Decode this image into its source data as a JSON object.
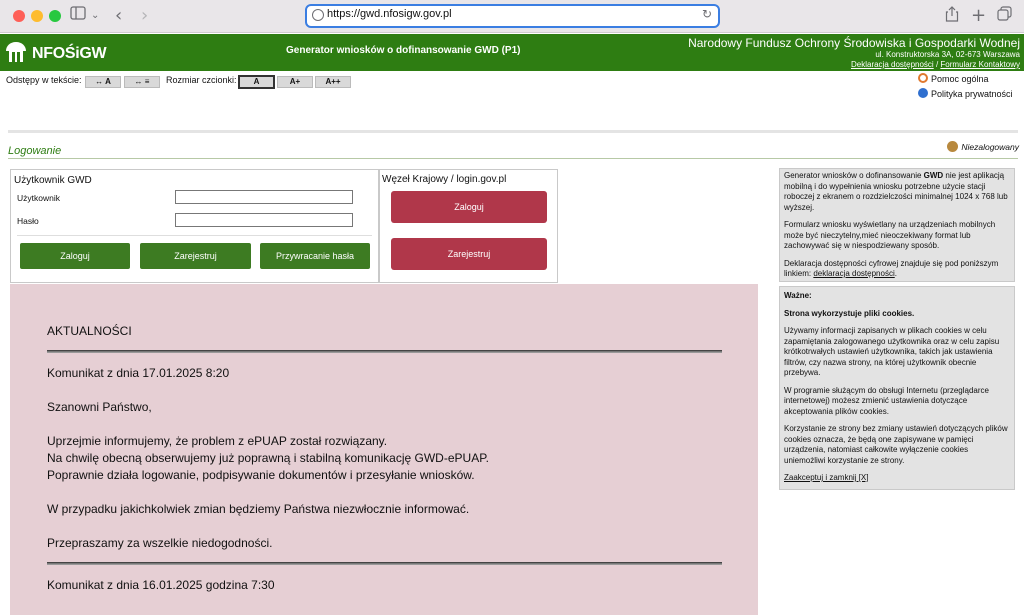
{
  "browser": {
    "url": "https://gwd.nfosigw.gov.pl"
  },
  "header": {
    "logo_text": "NFOŚiGW",
    "app_title": "Generator wniosków o dofinansowanie GWD (P1)",
    "org_name": "Narodowy Fundusz Ochrony Środowiska i Gospodarki Wodnej",
    "org_address": "ul. Konstruktorska 3A, 02-673 Warszawa",
    "link_accessibility": "Deklaracja dostępności",
    "link_separator": "/",
    "link_contact": "Formularz Kontaktowy"
  },
  "toolbar": {
    "spacing_label": "Odstępy w tekście:",
    "spacing_btn1": "↔ A",
    "spacing_btn2": "↔ ≡",
    "font_label": "Rozmiar czcionki:",
    "font_a": "A",
    "font_a_plus": "A+",
    "font_a_plus_plus": "A++"
  },
  "right_links": {
    "help": "Pomoc ogólna",
    "privacy": "Polityka prywatności"
  },
  "section": {
    "title": "Logowanie",
    "user_status": "Niezalogowany"
  },
  "gwd_login": {
    "title": "Użytkownik GWD",
    "user_label": "Użytkownik",
    "password_label": "Hasło",
    "user_value": "",
    "password_value": "",
    "login_btn": "Zaloguj",
    "register_btn": "Zarejestruj",
    "recover_btn": "Przywracanie hasła"
  },
  "national_login": {
    "title": "Węzeł Krajowy / login.gov.pl",
    "login_btn": "Zaloguj",
    "register_btn": "Zarejestruj"
  },
  "news": {
    "heading": "AKTUALNOŚCI",
    "item1_date": "Komunikat z dnia 17.01.2025 8:20",
    "greeting": "Szanowni Państwo,",
    "line1": "Uprzejmie informujemy, że problem z ePUAP został rozwiązany.",
    "line2": "Na chwilę obecną obserwujemy już poprawną i stabilną komunikację GWD-ePUAP.",
    "line3": "Poprawnie działa logowanie, podpisywanie dokumentów i przesyłanie wniosków.",
    "line4": "W przypadku jakichkolwiek zmian będziemy Państwa niezwłocznie informować.",
    "line5": "Przepraszamy za wszelkie niedogodności.",
    "item2_date": "Komunikat z dnia 16.01.2025 godzina 7:30"
  },
  "info1": {
    "p1_a": "Generator wniosków o dofinansowanie ",
    "p1_b": "GWD",
    "p1_c": " nie jest aplikacją mobilną i do wypełnienia wniosku potrzebne użycie stacji roboczej z ekranem o rozdzielczości minimalnej 1024 x 768 lub wyższej.",
    "p2": "Formularz wniosku wyświetlany na urządzeniach mobilnych może być nieczytelny,mieć nieoczekiwany format lub zachowywać się w niespodziewany sposób.",
    "p3_a": "Deklaracja dostępności cyfrowej znajduje się pod poniższym linkiem: ",
    "p3_link": "deklaracja dostępności",
    "p3_c": "."
  },
  "info2": {
    "heading": "Ważne:",
    "subheading": "Strona wykorzystuje pliki cookies.",
    "p1": "Używamy informacji zapisanych w plikach cookies w celu zapamiętania zalogowanego użytkownika oraz w celu zapisu krótkotrwałych ustawień użytkownika, takich jak ustawienia filtrów, czy nazwa strony, na której użytkownik obecnie przebywa.",
    "p2": "W programie służącym do obsługi Internetu (przeglądarce internetowej) możesz zmienić ustawienia dotyczące akceptowania plików cookies.",
    "p3": "Korzystanie ze strony bez zmiany ustawień dotyczących plików cookies oznacza, że będą one zapisywane w pamięci urządzenia, natomiast całkowite wyłączenie cookies uniemożliwi korzystanie ze strony.",
    "accept_link": "Zaakceptuj i zamknij [X]"
  },
  "colors": {
    "header_green": "#2e7d12",
    "button_green": "#3d7b22",
    "button_red": "#b0374a",
    "news_bg": "#e6cfd4"
  }
}
